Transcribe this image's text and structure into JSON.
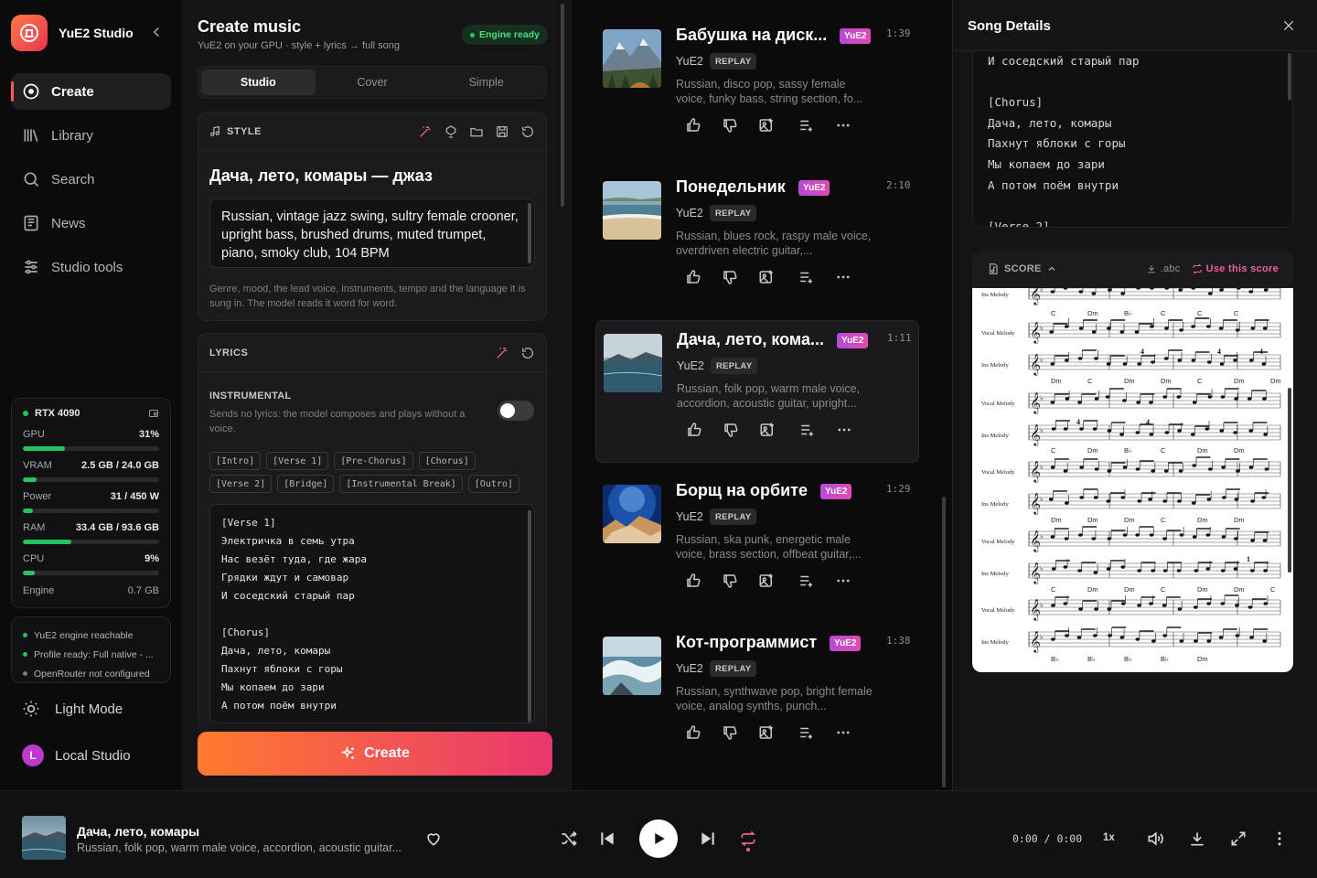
{
  "app": {
    "name": "YuE2 Studio"
  },
  "nav": [
    {
      "label": "Create",
      "icon": "create-icon",
      "active": true
    },
    {
      "label": "Library",
      "icon": "library-icon",
      "active": false
    },
    {
      "label": "Search",
      "icon": "search-icon",
      "active": false
    },
    {
      "label": "News",
      "icon": "news-icon",
      "active": false
    },
    {
      "label": "Studio tools",
      "icon": "sliders-icon",
      "active": false
    }
  ],
  "system": {
    "gpu_name": "RTX 4090",
    "metrics": [
      {
        "label": "GPU",
        "value": "31%",
        "fraction": 0.31
      },
      {
        "label": "VRAM",
        "value": "2.5 GB / 24.0 GB",
        "fraction": 0.104
      },
      {
        "label": "Power",
        "value": "31 / 450 W",
        "fraction": 0.069
      },
      {
        "label": "RAM",
        "value": "33.4 GB / 93.6 GB",
        "fraction": 0.357
      },
      {
        "label": "CPU",
        "value": "9%",
        "fraction": 0.09
      }
    ],
    "engine_label": "Engine",
    "engine_value": "0.7 GB",
    "status": [
      {
        "text": "YuE2 engine reachable",
        "ok": true
      },
      {
        "text": "Profile ready: Full native - ...",
        "ok": true
      },
      {
        "text": "OpenRouter not configured",
        "ok": false
      }
    ]
  },
  "bottom": {
    "theme_label": "Light Mode",
    "user_initial": "L",
    "user_label": "Local Studio"
  },
  "create": {
    "title": "Create music",
    "subtitle": "YuE2 on your GPU · style + lyrics → full song",
    "engine_badge": "Engine ready",
    "tabs": [
      "Studio",
      "Cover",
      "Simple"
    ],
    "active_tab": "Studio",
    "style_header": "STYLE",
    "song_title": "Дача, лето, комары — джаз",
    "style_text": "Russian, vintage jazz swing, sultry female crooner, upright bass, brushed drums, muted trumpet, piano, smoky club, 104 BPM",
    "style_hint": "Genre, mood, the lead voice, instruments, tempo and the language it is sung in. The model reads it word for word.",
    "lyrics_header": "LYRICS",
    "instrumental_label": "INSTRUMENTAL",
    "instrumental_desc": "Sends no lyrics: the model composes and plays without a voice.",
    "instrumental_on": false,
    "tags": [
      "[Intro]",
      "[Verse 1]",
      "[Pre-Chorus]",
      "[Chorus]",
      "[Verse 2]",
      "[Bridge]",
      "[Instrumental Break]",
      "[Outro]"
    ],
    "lyrics": [
      "[Verse 1]",
      "Электричка в семь утра",
      "Нас везёт туда, где жара",
      "Грядки ждут и самовар",
      "И соседский старый пар",
      "",
      "[Chorus]",
      "Дача, лето, комары",
      "Пахнут яблоки с горы",
      "Мы копаем до зари",
      "А потом поём внутри"
    ],
    "create_button": "Create"
  },
  "songs": [
    {
      "title": "Бабушка на диск...",
      "badge": "YuE2",
      "time": "1:39",
      "model": "YuE2",
      "replay": "REPLAY",
      "desc": "Russian, disco pop, sassy female voice, funky bass, string section, fo...",
      "selected": false,
      "thumb": "mountain"
    },
    {
      "title": "Понедельник",
      "badge": "YuE2",
      "time": "2:10",
      "model": "YuE2",
      "replay": "REPLAY",
      "desc": "Russian, blues rock, raspy male voice, overdriven electric guitar,...",
      "selected": false,
      "thumb": "beach"
    },
    {
      "title": "Дача, лето, кома...",
      "badge": "YuE2",
      "time": "1:11",
      "model": "YuE2",
      "replay": "REPLAY",
      "desc": "Russian, folk pop, warm male voice, accordion, acoustic guitar, upright...",
      "selected": true,
      "thumb": "lake"
    },
    {
      "title": "Борщ на орбите",
      "badge": "YuE2",
      "time": "1:29",
      "model": "YuE2",
      "replay": "REPLAY",
      "desc": "Russian, ska punk, energetic male voice, brass section, offbeat guitar,...",
      "selected": false,
      "thumb": "space"
    },
    {
      "title": "Кот-программист",
      "badge": "YuE2",
      "time": "1:38",
      "model": "YuE2",
      "replay": "REPLAY",
      "desc": "Russian, synthwave pop, bright female voice, analog synths, punch...",
      "selected": false,
      "thumb": "wave"
    }
  ],
  "details": {
    "title": "Song Details",
    "lyrics": [
      "И соседский старый пар",
      "",
      "[Chorus]",
      "Дача, лето, комары",
      "Пахнут яблоки с горы",
      "Мы копаем до зари",
      "А потом поём внутри",
      "",
      "[Verse 2]"
    ],
    "score_label": "SCORE",
    "abc_label": ".abc",
    "use_score_label": "Use this score",
    "staff_labels": [
      "Ins Melody",
      "Vocal Melody",
      "Ins Melody",
      "Vocal Melody",
      "Ins Melody",
      "Vocal Melody",
      "Ins Melody",
      "Vocal Melody",
      "Ins Melody",
      "Vocal Melody",
      "Ins Melody"
    ],
    "chords": [
      [
        "C",
        "Dm",
        "B♭",
        "C",
        "C",
        "C"
      ],
      [
        "Dm",
        "C",
        "Dm",
        "Dm",
        "C",
        "Dm",
        "Dm"
      ],
      [
        "C",
        "Dm",
        "B♭",
        "C",
        "Dm",
        "Dm"
      ],
      [
        "Dm",
        "Dm",
        "Dm",
        "C",
        "Dm",
        "Dm"
      ],
      [
        "C",
        "Dm",
        "Dm",
        "C",
        "Dm",
        "Dm",
        "C"
      ],
      [
        "B♭",
        "B♭",
        "B♭",
        "B♭",
        "Dm"
      ]
    ],
    "measure_numbers": [
      "4",
      "4",
      "4",
      "4",
      "4",
      "1"
    ]
  },
  "player": {
    "title": "Дача, лето, комары",
    "desc": "Russian, folk pop, warm male voice, accordion, acoustic guitar...",
    "time": "0:00 / 0:00",
    "speed": "1x"
  },
  "colors": {
    "accent": "#e83770",
    "accent_orange": "#ff7a2e",
    "ok": "#22c55e",
    "pink": "#f0609a"
  }
}
